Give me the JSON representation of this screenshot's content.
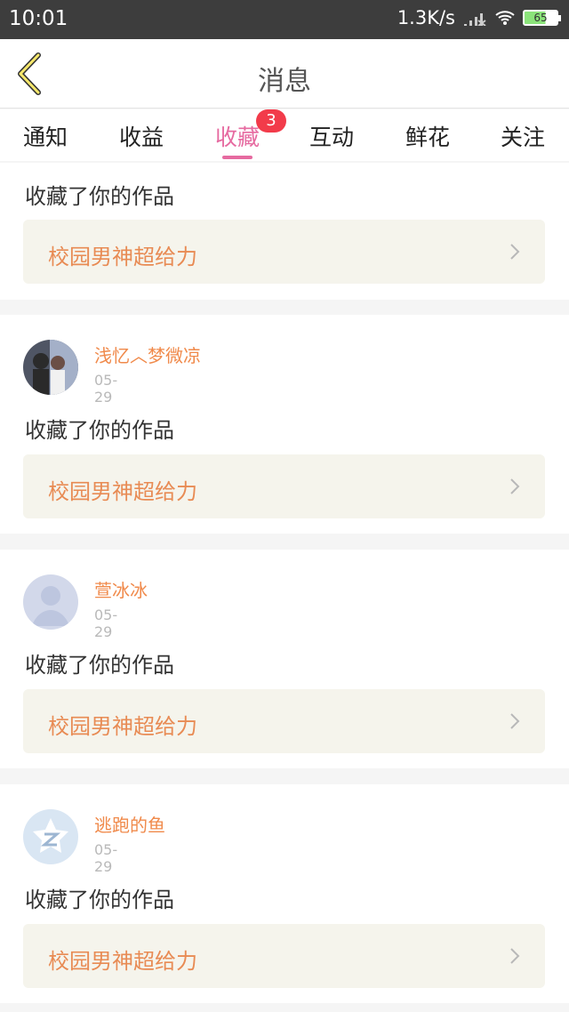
{
  "status": {
    "time": "10:01",
    "speed": "1.3K/s",
    "battery": "65"
  },
  "header": {
    "title": "消息"
  },
  "tabs": [
    {
      "label": "通知"
    },
    {
      "label": "收益"
    },
    {
      "label": "收藏",
      "badge": "3"
    },
    {
      "label": "互动"
    },
    {
      "label": "鲜花"
    },
    {
      "label": "关注"
    }
  ],
  "items": [
    {
      "action": "收藏了你的作品",
      "work": "校园男神超给力"
    },
    {
      "user": "浅忆︿梦微凉",
      "date": "05-29",
      "action": "收藏了你的作品",
      "work": "校园男神超给力"
    },
    {
      "user": "萱冰冰",
      "date": "05-29",
      "action": "收藏了你的作品",
      "work": "校园男神超给力"
    },
    {
      "user": "逃跑的鱼",
      "date": "05-29",
      "action": "收藏了你的作品",
      "work": "校园男神超给力"
    }
  ],
  "colors": {
    "accent": "#e66aa0",
    "orange": "#e88b54",
    "badge": "#f23b4a"
  }
}
